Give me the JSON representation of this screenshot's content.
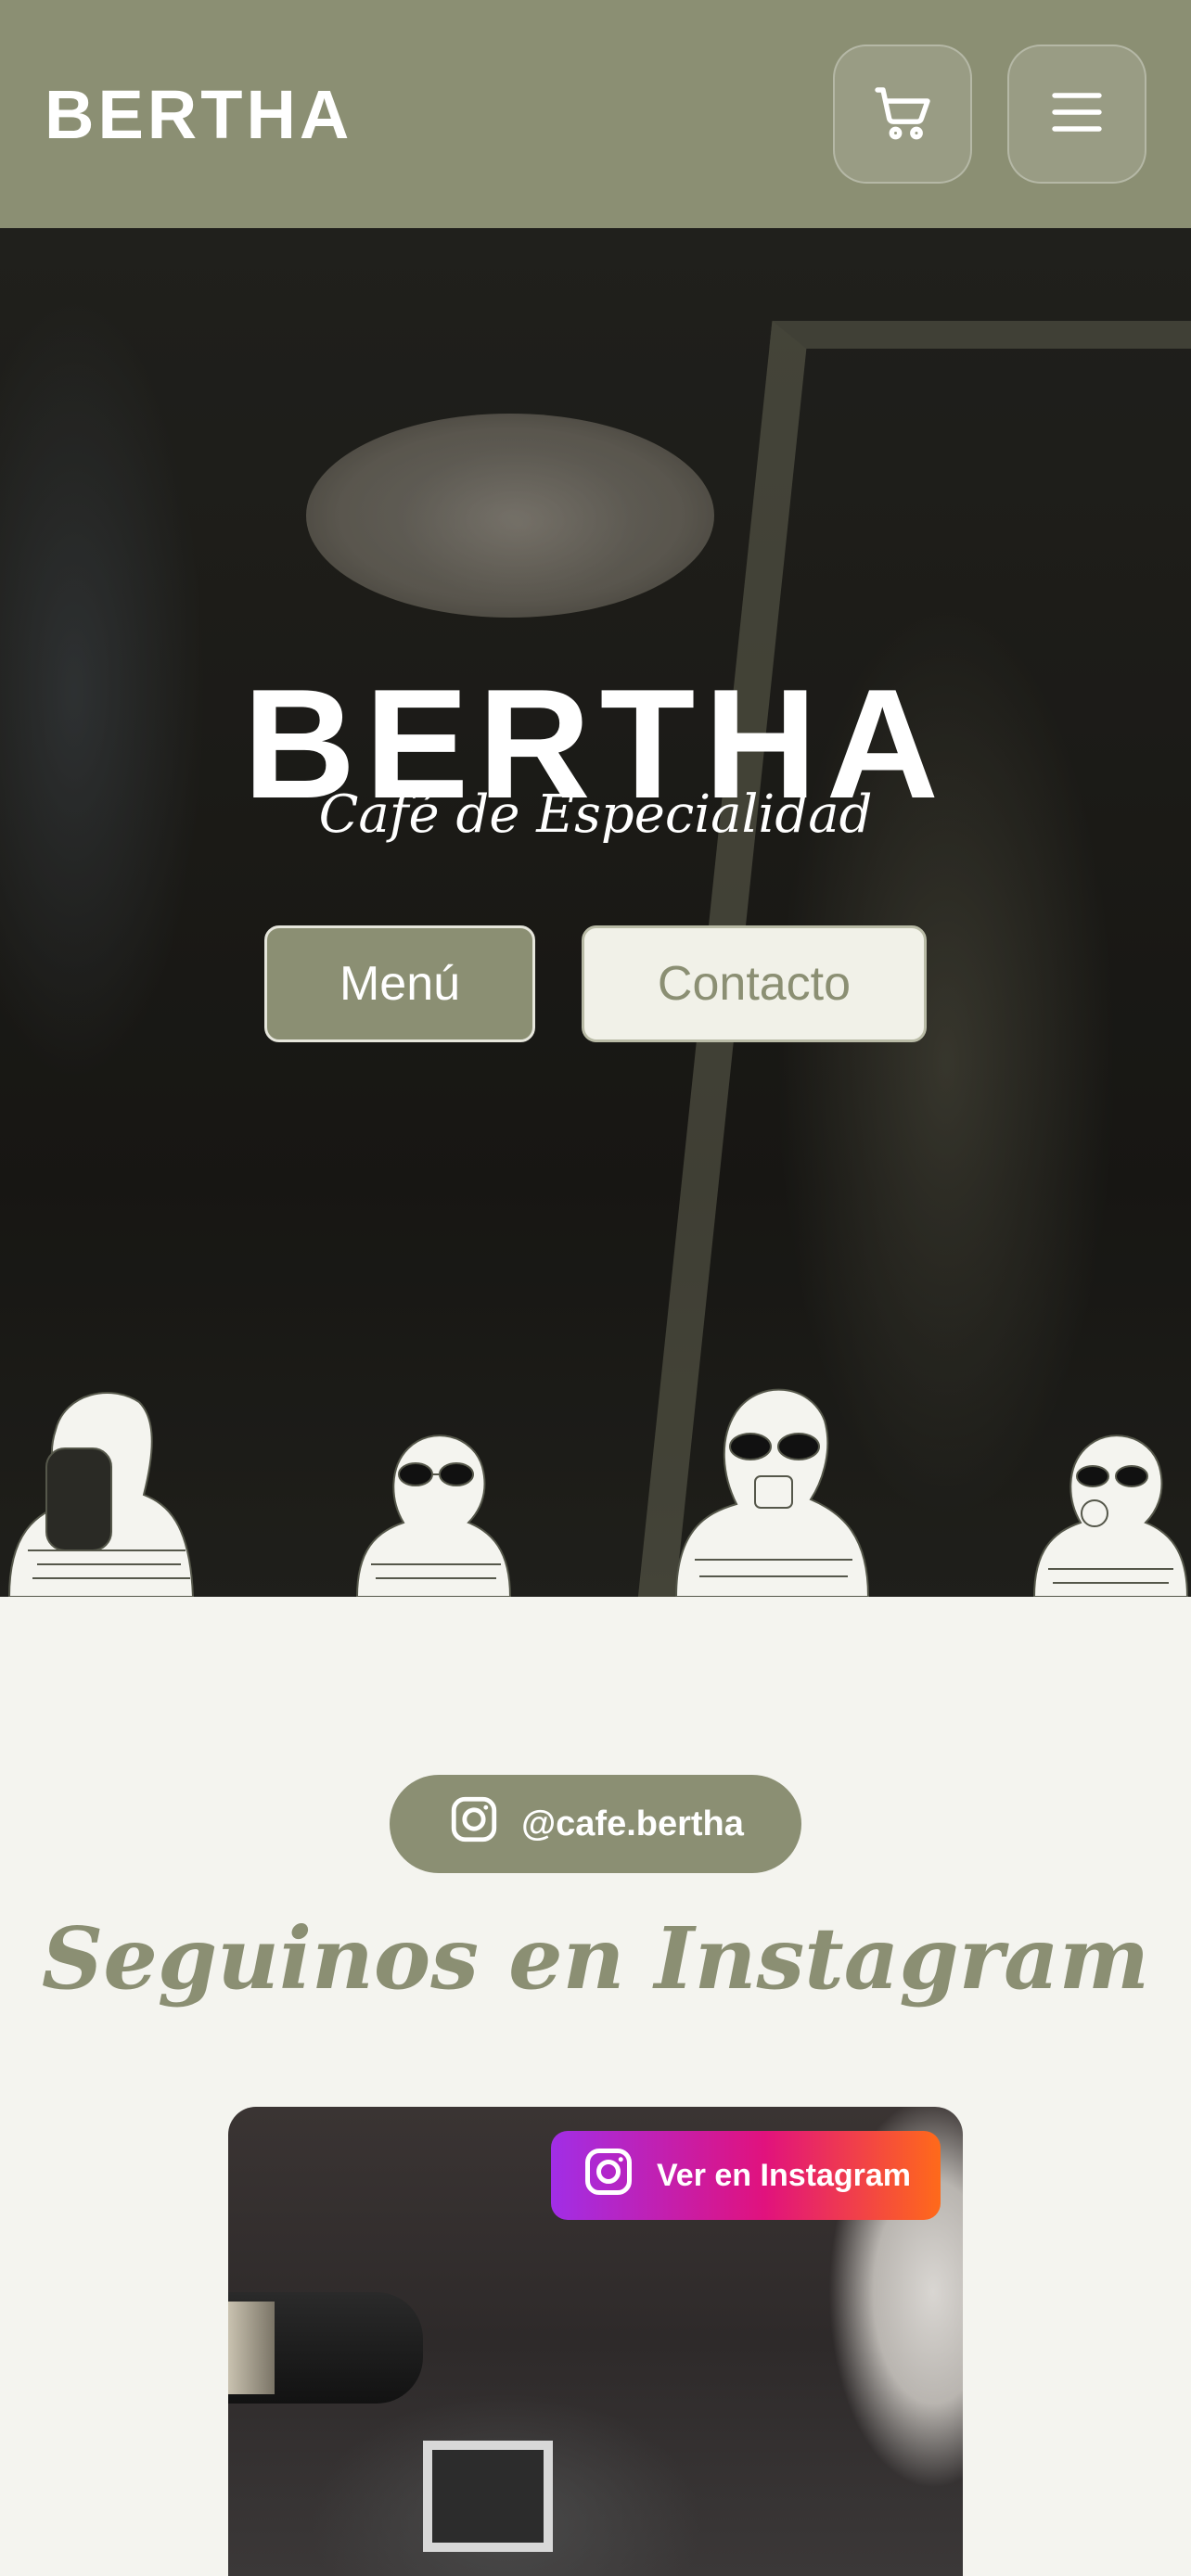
{
  "header": {
    "brand": "BERTHA",
    "cart_icon": "cart-icon",
    "menu_icon": "hamburger-menu-icon"
  },
  "hero": {
    "title": "BERTHA",
    "subtitle": "Café de Especialidad",
    "buttons": {
      "menu_label": "Menú",
      "contact_label": "Contacto"
    }
  },
  "instagram": {
    "handle": "@cafe.bertha",
    "section_title": "Seguinos en Instagram",
    "view_label": "Ver en Instagram",
    "icon": "instagram-icon"
  },
  "colors": {
    "brand_olive": "#8b8f73",
    "page_bg": "#f4f4ef",
    "instagram_gradient_start": "#a12ee6",
    "instagram_gradient_end": "#ff6a1a"
  }
}
